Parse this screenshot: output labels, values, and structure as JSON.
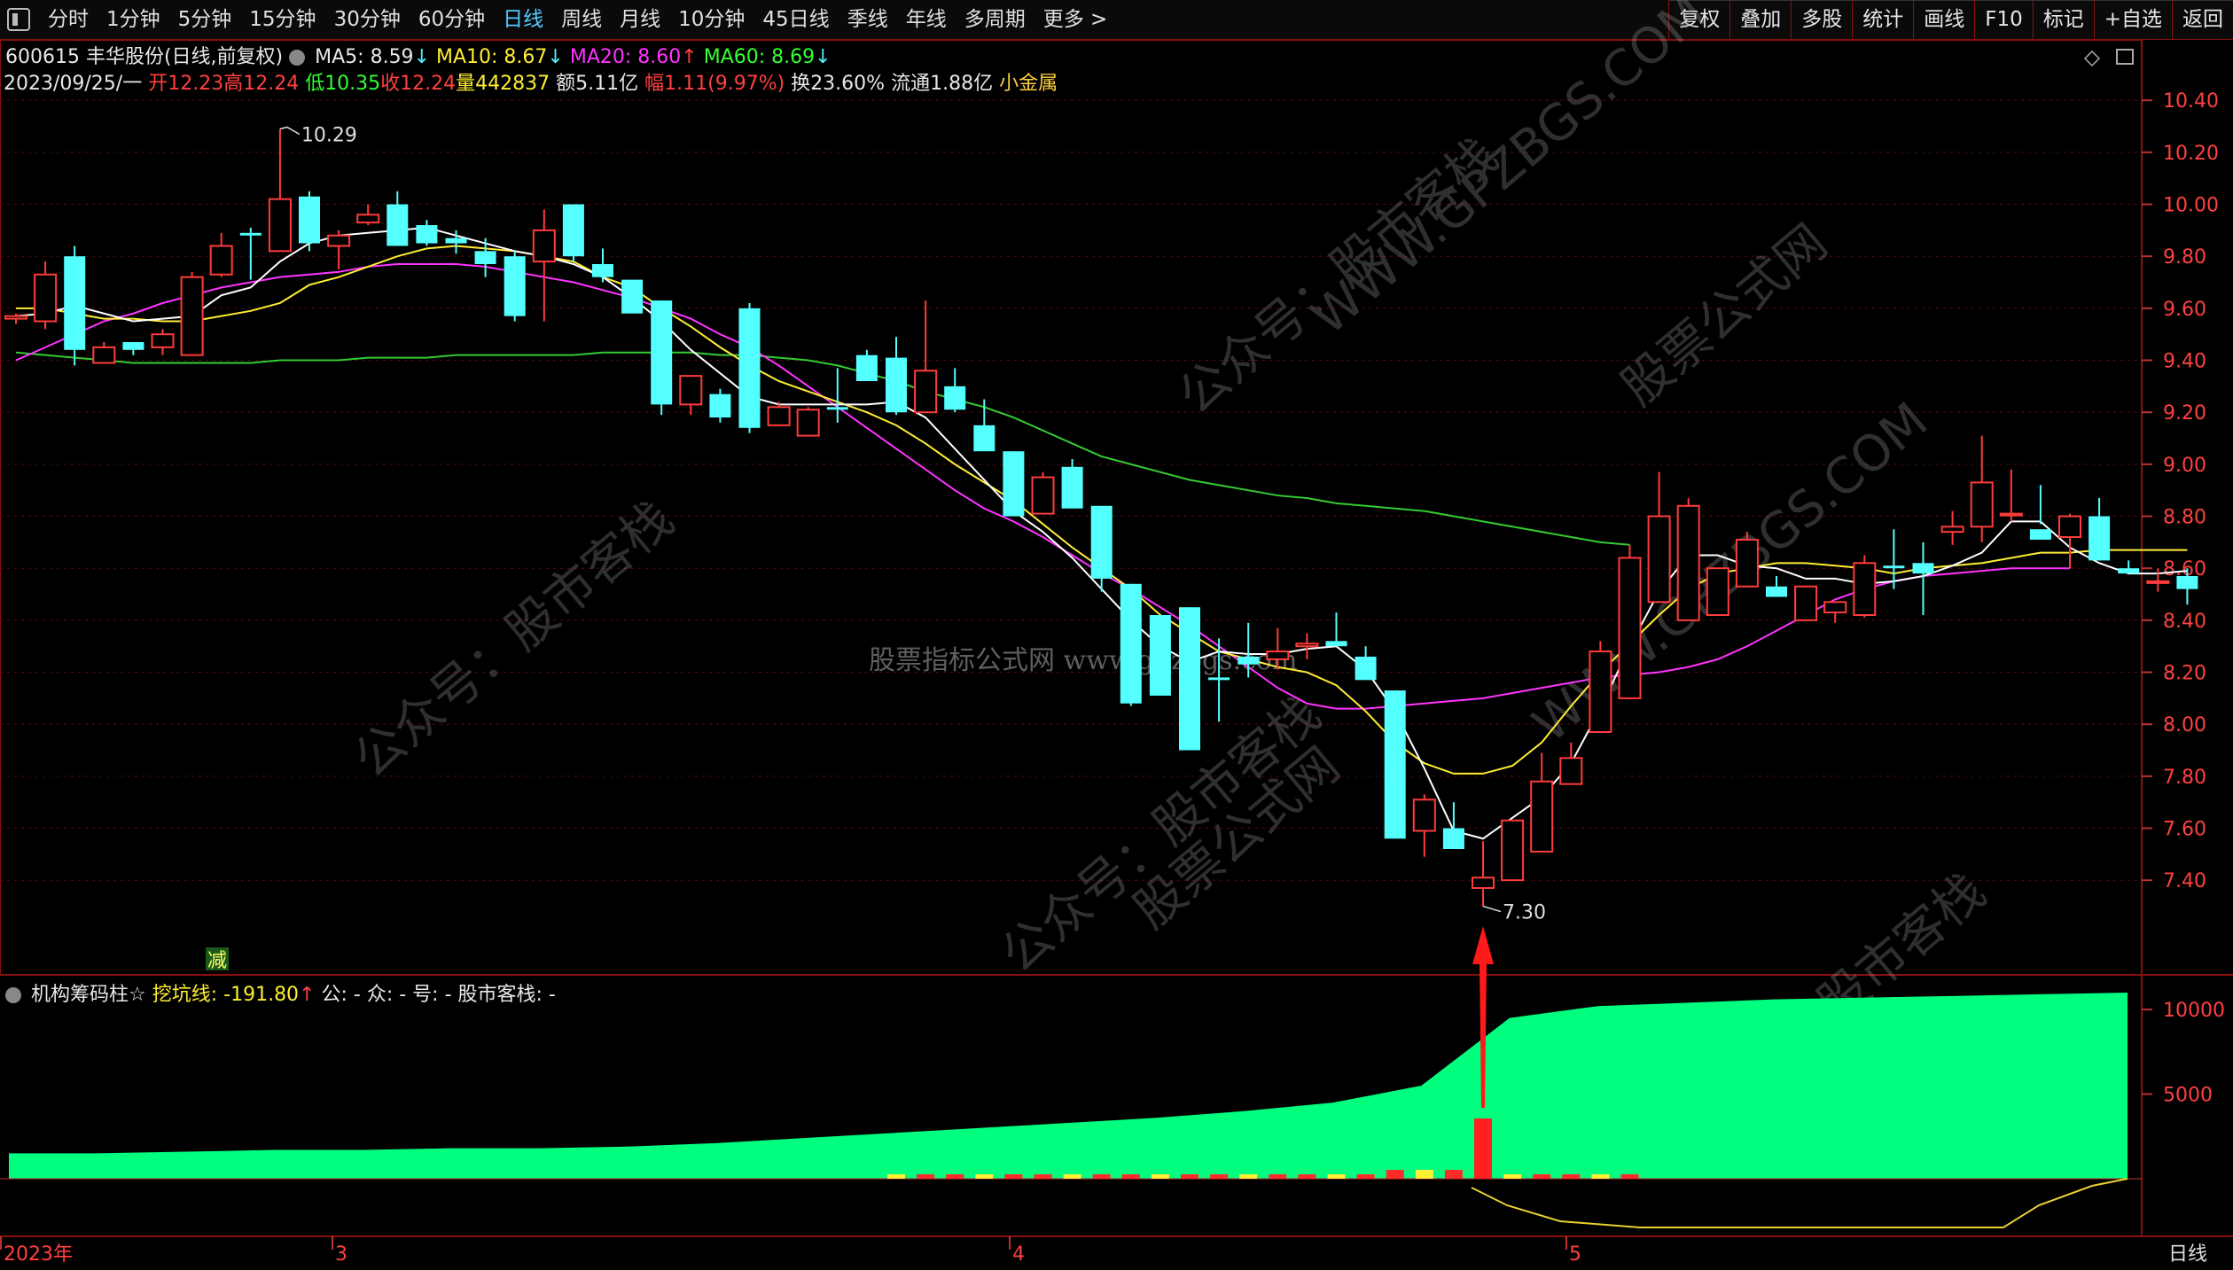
{
  "toolbar": {
    "periods": [
      "分时",
      "1分钟",
      "5分钟",
      "15分钟",
      "30分钟",
      "60分钟",
      "日线",
      "周线",
      "月线",
      "10分钟",
      "45日线",
      "季线",
      "年线",
      "多周期",
      "更多 >"
    ],
    "active_period": "日线",
    "right_buttons": [
      "复权",
      "叠加",
      "多股",
      "统计",
      "画线",
      "F10",
      "标记",
      "+自选",
      "返回"
    ]
  },
  "header": {
    "stock": "600615 丰华股份(日线,前复权)",
    "ma5": "MA5: 8.59",
    "ma10": "MA10: 8.67",
    "ma20": "MA20: 8.60",
    "ma60": "MA60: 8.69"
  },
  "bar_info": {
    "date": "2023/09/25/一",
    "open": "开12.23",
    "high": "高12.24",
    "low": "低10.35",
    "close": "收12.24",
    "volume": "量442837",
    "amount": "额5.11亿",
    "change": "幅1.11(9.97%)",
    "turnover": "换23.60%",
    "float": "流通1.88亿",
    "sector": "小金属"
  },
  "indicator": {
    "name": "机构筹码柱☆",
    "line": "挖坑线: -191.80",
    "extra": "公: - 众: - 号: - 股市客栈: -"
  },
  "labels": {
    "high_mark": "10.29",
    "low_mark": "7.30",
    "reduce_tag": "减",
    "watermark": "股票指标公式网 www.gpzbgs.com",
    "wm1": "公众号：股市客栈",
    "wm2": "WWW.GPZBGS.COM",
    "wm3": "股票公式网"
  },
  "colors": {
    "up": "#ff3b3b",
    "down": "#54ffff",
    "ma5": "#ffffff",
    "ma10": "#ffee33",
    "ma20": "#ff33ff",
    "ma60": "#33cc33",
    "fill": "#00ff7f"
  },
  "chart_data": [
    {
      "type": "candlestick",
      "y_axis_ticks": [
        10.4,
        10.2,
        10.0,
        9.8,
        9.6,
        9.4,
        9.2,
        9.0,
        8.8,
        8.6,
        8.4,
        8.2,
        8.0,
        7.8,
        7.6,
        7.4
      ],
      "ylim": [
        7.22,
        10.52
      ],
      "x_ticks": [
        "2023年",
        "3",
        "4",
        "5"
      ],
      "candles": [
        [
          9.56,
          9.58,
          9.54,
          9.57
        ],
        [
          9.55,
          9.78,
          9.52,
          9.73
        ],
        [
          9.8,
          9.84,
          9.38,
          9.44
        ],
        [
          9.39,
          9.47,
          9.39,
          9.45
        ],
        [
          9.47,
          9.47,
          9.42,
          9.44
        ],
        [
          9.45,
          9.52,
          9.42,
          9.5
        ],
        [
          9.42,
          9.74,
          9.42,
          9.72
        ],
        [
          9.73,
          9.89,
          9.72,
          9.84
        ],
        [
          9.89,
          9.91,
          9.71,
          9.88
        ],
        [
          9.82,
          10.29,
          9.82,
          10.02
        ],
        [
          10.03,
          10.05,
          9.82,
          9.85
        ],
        [
          9.84,
          9.9,
          9.75,
          9.88
        ],
        [
          9.93,
          10.0,
          9.92,
          9.96
        ],
        [
          10.0,
          10.05,
          9.85,
          9.84
        ],
        [
          9.92,
          9.94,
          9.84,
          9.85
        ],
        [
          9.87,
          9.9,
          9.81,
          9.85
        ],
        [
          9.82,
          9.87,
          9.72,
          9.77
        ],
        [
          9.8,
          9.82,
          9.55,
          9.57
        ],
        [
          9.78,
          9.98,
          9.55,
          9.9
        ],
        [
          10.0,
          10.0,
          9.78,
          9.8
        ],
        [
          9.77,
          9.83,
          9.7,
          9.72
        ],
        [
          9.71,
          9.71,
          9.61,
          9.58
        ],
        [
          9.63,
          9.63,
          9.19,
          9.23
        ],
        [
          9.23,
          9.34,
          9.19,
          9.34
        ],
        [
          9.27,
          9.29,
          9.16,
          9.18
        ],
        [
          9.6,
          9.62,
          9.12,
          9.14
        ],
        [
          9.15,
          9.24,
          9.15,
          9.22
        ],
        [
          9.11,
          9.22,
          9.11,
          9.21
        ],
        [
          9.22,
          9.37,
          9.16,
          9.21
        ],
        [
          9.42,
          9.44,
          9.33,
          9.32
        ],
        [
          9.41,
          9.49,
          9.19,
          9.2
        ],
        [
          9.2,
          9.63,
          9.2,
          9.36
        ],
        [
          9.3,
          9.37,
          9.2,
          9.21
        ],
        [
          9.15,
          9.25,
          9.06,
          9.05
        ],
        [
          9.05,
          9.05,
          8.85,
          8.8
        ],
        [
          8.81,
          8.97,
          8.81,
          8.95
        ],
        [
          8.99,
          9.02,
          8.9,
          8.83
        ],
        [
          8.84,
          8.84,
          8.51,
          8.56
        ],
        [
          8.54,
          8.54,
          8.07,
          8.08
        ],
        [
          8.42,
          8.42,
          8.33,
          8.11
        ],
        [
          8.45,
          8.45,
          7.97,
          7.9
        ],
        [
          8.18,
          8.33,
          8.01,
          8.17
        ],
        [
          8.26,
          8.39,
          8.18,
          8.23
        ],
        [
          8.25,
          8.37,
          8.21,
          8.28
        ],
        [
          8.3,
          8.35,
          8.25,
          8.31
        ],
        [
          8.32,
          8.43,
          8.32,
          8.3
        ],
        [
          8.26,
          8.3,
          8.2,
          8.17
        ],
        [
          8.13,
          8.13,
          7.62,
          7.56
        ],
        [
          7.59,
          7.73,
          7.49,
          7.71
        ],
        [
          7.6,
          7.7,
          7.56,
          7.52
        ],
        [
          7.37,
          7.55,
          7.3,
          7.41
        ],
        [
          7.4,
          7.63,
          7.4,
          7.63
        ],
        [
          7.51,
          7.89,
          7.51,
          7.78
        ],
        [
          7.77,
          7.93,
          7.77,
          7.87
        ],
        [
          7.97,
          8.32,
          7.97,
          8.28
        ],
        [
          8.1,
          8.69,
          8.1,
          8.64
        ],
        [
          8.47,
          8.97,
          8.47,
          8.8
        ],
        [
          8.4,
          8.87,
          8.4,
          8.84
        ],
        [
          8.42,
          8.56,
          8.45,
          8.6
        ],
        [
          8.53,
          8.74,
          8.53,
          8.71
        ],
        [
          8.53,
          8.57,
          8.53,
          8.49
        ],
        [
          8.4,
          8.53,
          8.4,
          8.53
        ],
        [
          8.43,
          8.47,
          8.39,
          8.47
        ],
        [
          8.42,
          8.65,
          8.41,
          8.62
        ],
        [
          8.61,
          8.75,
          8.52,
          8.6
        ],
        [
          8.62,
          8.7,
          8.42,
          8.58
        ],
        [
          8.74,
          8.82,
          8.69,
          8.76
        ],
        [
          8.76,
          9.11,
          8.7,
          8.93
        ],
        [
          8.81,
          8.98,
          8.78,
          8.81
        ],
        [
          8.75,
          8.92,
          8.77,
          8.71
        ],
        [
          8.72,
          8.81,
          8.6,
          8.8
        ],
        [
          8.8,
          8.87,
          8.63,
          8.63
        ],
        [
          8.6,
          8.63,
          8.59,
          8.58
        ],
        [
          8.55,
          8.6,
          8.51,
          8.55
        ],
        [
          8.57,
          8.6,
          8.46,
          8.52
        ]
      ],
      "ma5": [
        9.57,
        9.58,
        9.61,
        9.58,
        9.55,
        9.56,
        9.57,
        9.65,
        9.68,
        9.78,
        9.85,
        9.88,
        9.89,
        9.9,
        9.91,
        9.88,
        9.85,
        9.82,
        9.8,
        9.77,
        9.72,
        9.64,
        9.55,
        9.44,
        9.35,
        9.26,
        9.23,
        9.23,
        9.23,
        9.23,
        9.24,
        9.18,
        9.06,
        8.94,
        8.82,
        8.74,
        8.64,
        8.52,
        8.4,
        8.3,
        8.24,
        8.28,
        8.27,
        8.27,
        8.29,
        8.3,
        8.21,
        8.05,
        7.83,
        7.59,
        7.56,
        7.64,
        7.72,
        7.85,
        8.06,
        8.3,
        8.51,
        8.65,
        8.65,
        8.61,
        8.6,
        8.56,
        8.56,
        8.54,
        8.55,
        8.57,
        8.61,
        8.66,
        8.78,
        8.78,
        8.68,
        8.62,
        8.58,
        8.58,
        8.59
      ],
      "ma10": [
        9.6,
        9.6,
        9.58,
        9.56,
        9.56,
        9.55,
        9.55,
        9.57,
        9.59,
        9.62,
        9.69,
        9.72,
        9.76,
        9.8,
        9.83,
        9.84,
        9.83,
        9.82,
        9.8,
        9.78,
        9.72,
        9.68,
        9.6,
        9.53,
        9.45,
        9.38,
        9.32,
        9.28,
        9.24,
        9.2,
        9.15,
        9.08,
        9.0,
        8.93,
        8.86,
        8.77,
        8.68,
        8.6,
        8.52,
        8.42,
        8.35,
        8.28,
        8.25,
        8.22,
        8.2,
        8.15,
        8.05,
        7.93,
        7.85,
        7.81,
        7.81,
        7.84,
        7.93,
        8.07,
        8.2,
        8.31,
        8.42,
        8.52,
        8.58,
        8.6,
        8.62,
        8.62,
        8.61,
        8.6,
        8.58,
        8.6,
        8.61,
        8.62,
        8.64,
        8.66,
        8.66,
        8.67,
        8.67,
        8.67,
        8.67
      ],
      "ma20": [
        9.4,
        9.45,
        9.5,
        9.55,
        9.58,
        9.62,
        9.65,
        9.68,
        9.7,
        9.72,
        9.73,
        9.74,
        9.76,
        9.77,
        9.77,
        9.77,
        9.76,
        9.74,
        9.72,
        9.7,
        9.67,
        9.64,
        9.6,
        9.56,
        9.5,
        9.45,
        9.38,
        9.3,
        9.22,
        9.14,
        9.06,
        8.98,
        8.9,
        8.83,
        8.78,
        8.72,
        8.65,
        8.58,
        8.52,
        8.45,
        8.38,
        8.3,
        8.22,
        8.14,
        8.08,
        8.06,
        8.06,
        8.07,
        8.08,
        8.09,
        8.1,
        8.12,
        8.14,
        8.16,
        8.18,
        8.19,
        8.2,
        8.22,
        8.25,
        8.3,
        8.36,
        8.42,
        8.48,
        8.52,
        8.55,
        8.57,
        8.58,
        8.59,
        8.6,
        8.6,
        8.6
      ],
      "ma60": [
        9.43,
        9.42,
        9.41,
        9.4,
        9.39,
        9.39,
        9.39,
        9.39,
        9.39,
        9.4,
        9.4,
        9.4,
        9.41,
        9.41,
        9.41,
        9.42,
        9.42,
        9.42,
        9.42,
        9.42,
        9.43,
        9.43,
        9.43,
        9.43,
        9.42,
        9.42,
        9.41,
        9.4,
        9.38,
        9.35,
        9.32,
        9.28,
        9.25,
        9.22,
        9.18,
        9.13,
        9.08,
        9.03,
        9.0,
        8.97,
        8.94,
        8.92,
        8.9,
        8.88,
        8.87,
        8.85,
        8.84,
        8.83,
        8.82,
        8.8,
        8.78,
        8.76,
        8.74,
        8.72,
        8.7,
        8.69
      ]
    },
    {
      "type": "area",
      "y_axis_ticks": [
        10000,
        5000
      ],
      "ylim": [
        0,
        11000
      ],
      "series": [
        {
          "values": [
            1500,
            1500,
            1600,
            1700,
            1700,
            1800,
            1800,
            1900,
            2100,
            2400,
            2700,
            3000,
            3300,
            3600,
            4000,
            4500,
            5500,
            9500,
            10200,
            10400,
            10600,
            10700,
            10800,
            10900,
            11000
          ]
        }
      ]
    }
  ]
}
